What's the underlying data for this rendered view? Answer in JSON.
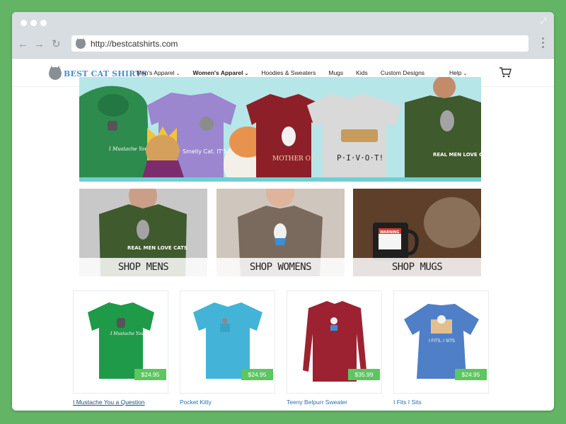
{
  "browser": {
    "url": "http://bestcatshirts.com"
  },
  "site": {
    "logo_text": "BEST CAT SHIRTS",
    "menu": [
      {
        "label": "Men's Apparel",
        "has_dropdown": true
      },
      {
        "label": "Women's Apparel",
        "has_dropdown": true
      },
      {
        "label": "Hoodies & Sweaters",
        "has_dropdown": false
      },
      {
        "label": "Mugs",
        "has_dropdown": false
      },
      {
        "label": "Kids",
        "has_dropdown": false
      },
      {
        "label": "Custom Designs",
        "has_dropdown": false
      }
    ],
    "help_label": "Help",
    "cart_icon": "cart-icon",
    "brand_color": "#4a8fd3"
  },
  "hero": {
    "shirts": [
      {
        "text": "I Mustache You a Question",
        "color": "#2e8b4e"
      },
      {
        "text": "Smelly Cat. IT'S NOT YOUR FAULT",
        "color": "#9b86cf"
      },
      {
        "text": "MOTHER OF CATS",
        "color": "#8d1f28"
      },
      {
        "text": "P·I·V·O·T!",
        "color": "#d9d9d9"
      },
      {
        "text": "REAL MEN LOVE CATS",
        "color": "#3f5a2d"
      }
    ]
  },
  "shop_panels": [
    {
      "label": "SHOP MENS",
      "shirt_text": "REAL MEN LOVE CATS"
    },
    {
      "label": "SHOP WOMENS"
    },
    {
      "label": "SHOP MUGS",
      "mug_text": "WARNING"
    }
  ],
  "products": [
    {
      "name": "I Mustache You a Question",
      "price": "$24.95",
      "shirt_text": "I Mustache You a Question",
      "color": "#1f9a49"
    },
    {
      "name": "Pocket Kitty",
      "price": "$24.95",
      "color": "#43b4d8"
    },
    {
      "name": "Teeny Belpurr Sweater",
      "price": "$35.99",
      "color": "#9c2232"
    },
    {
      "name": "I Fits I Sits",
      "price": "$24.95",
      "shirt_text": "I FITS, I SITS",
      "color": "#4f7fc7"
    }
  ]
}
